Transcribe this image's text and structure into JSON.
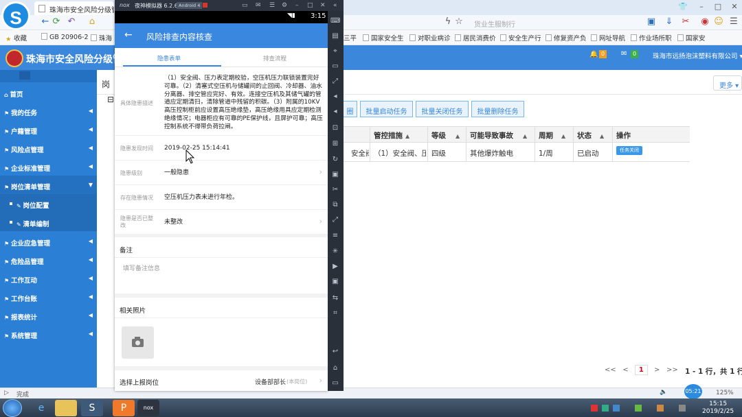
{
  "browser": {
    "tab_title": "珠海市安全风险分级管...",
    "url_placeholder": "货业生服制行",
    "logo_letter": "S",
    "bookmarks": [
      "收藏",
      "GB 20906-2",
      "珠海",
      "三平",
      "国家安全生",
      "对职业病诊",
      "居民消费价",
      "安全生产行",
      "修复资产负",
      "网址导航",
      "作业场所职",
      "国家安"
    ]
  },
  "app": {
    "title": "珠海市安全风险分级管",
    "company": "珠海市远扬泡沫塑料有限公司",
    "bell_count": "0",
    "mail_count": "0",
    "menu": [
      {
        "label": "首页",
        "arrow": ""
      },
      {
        "label": "我的任务",
        "arrow": "◀"
      },
      {
        "label": "户籍管理",
        "arrow": "◀"
      },
      {
        "label": "风险点管理",
        "arrow": "◀"
      },
      {
        "label": "企业标准管理",
        "arrow": "◀"
      },
      {
        "label": "岗位清单管理",
        "arrow": "▼"
      },
      {
        "label": "岗位配置",
        "arrow": ""
      },
      {
        "label": "清单编制",
        "arrow": ""
      },
      {
        "label": "企业应急管理",
        "arrow": "◀"
      },
      {
        "label": "危险品管理",
        "arrow": "◀"
      },
      {
        "label": "工作互动",
        "arrow": "◀"
      },
      {
        "label": "工作台账",
        "arrow": "◀"
      },
      {
        "label": "报表统计",
        "arrow": "◀"
      },
      {
        "label": "系统管理",
        "arrow": "◀"
      }
    ],
    "content_tab": "岗",
    "more_button": "更多",
    "batch_buttons": [
      "批量启动任务",
      "批量关闭任务",
      "批量删除任务"
    ],
    "batch_partial": "圈",
    "table": {
      "headers": [
        "管控措施",
        "等级",
        "可能导致事故",
        "周期",
        "状态",
        "操作"
      ],
      "row": {
        "partial": "安全阀",
        "measure": "（1）安全阀、压",
        "level": "四级",
        "accident": "其他爆炸触电",
        "period": "1/周",
        "status": "已启动",
        "op_button": "任务关闭"
      }
    },
    "pager": {
      "first": "<<",
      "prev": "<",
      "current": "1",
      "next": ">",
      "last": ">>",
      "info": "1 - 1 行，共 1 行"
    }
  },
  "emulator": {
    "brand": "nox",
    "name": "夜神模拟器 6.2.6.3",
    "android": "Android 4",
    "time": "3:15",
    "page_title": "风险排查内容核查",
    "tabs": [
      "隐患表单",
      "排查流程"
    ],
    "fields": {
      "desc_label": "具体隐患描述",
      "desc_value": "（1）安全阀、压力表定期校验，空压机压力联锁装置完好可靠。（2）清塞式空压机与储罐间的止回阀、冷却器、油水分离器、排空管应完好、有效。连接空压机及其储气罐的管道应定期清扫，清除管道中残留的积碳。（3）附属的10KV高压控制柜前应设置高压绝缘垫，高压绝缘用具应定期检测绝缘情况；电器柜应有可靠的PE保护线，且屏护可靠；高压控制系统不得带负荷拉闸。",
      "time_label": "隐患发现时间",
      "time_value": "2019-02-25 15:14:41",
      "level_label": "隐患级别",
      "level_value": "一般隐患",
      "situation_label": "存在隐患情况",
      "situation_value": "空压机压力表未进行年检。",
      "fixed_label": "隐患是否已整改",
      "fixed_value": "未整改",
      "remark_title": "备注",
      "remark_placeholder": "填写备注信息",
      "photo_title": "相关照片",
      "report_label": "选择上报岗位",
      "report_value": "设备部部长",
      "report_hint": "(本岗位)"
    }
  },
  "statusbar": {
    "left": "完成",
    "zoom": "125%",
    "badge": "05:21"
  },
  "taskbar": {
    "time": "15:15",
    "date": "2019/2/25"
  }
}
